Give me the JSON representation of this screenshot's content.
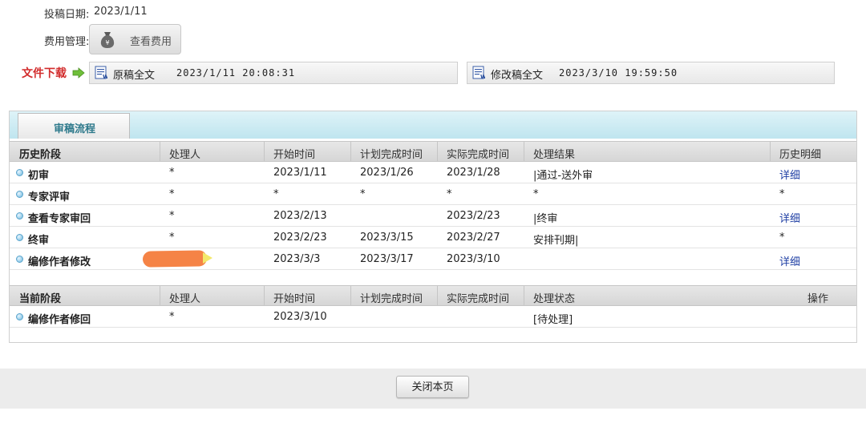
{
  "info": {
    "submit_date_label": "投稿日期:",
    "submit_date_value": "2023/1/11",
    "fee_label": "费用管理:",
    "fee_button": "查看费用"
  },
  "download": {
    "label": "文件下载",
    "original": {
      "name": "原稿全文",
      "time": "2023/1/11 20:08:31"
    },
    "revised": {
      "name": "修改稿全文",
      "time": "2023/3/10 19:59:50"
    }
  },
  "process": {
    "tab_label": "审稿流程",
    "history": {
      "headers": [
        "历史阶段",
        "处理人",
        "开始时间",
        "计划完成时间",
        "实际完成时间",
        "处理结果",
        "历史明细"
      ],
      "rows": [
        {
          "stage": "初审",
          "handler": "*",
          "start": "2023/1/11",
          "plan": "2023/1/26",
          "actual": "2023/1/28",
          "result": "|通过-送外审",
          "detail": "详细"
        },
        {
          "stage": "专家评审",
          "handler": "*",
          "start": "*",
          "plan": "*",
          "actual": "*",
          "result": "*",
          "detail": "*"
        },
        {
          "stage": "查看专家审回",
          "handler": "*",
          "start": "2023/2/13",
          "plan": "",
          "actual": "2023/2/23",
          "result": "|终审",
          "detail": "详细"
        },
        {
          "stage": "终审",
          "handler": "*",
          "start": "2023/2/23",
          "plan": "2023/3/15",
          "actual": "2023/2/27",
          "result": "安排刊期|",
          "detail": "*"
        },
        {
          "stage": "编修作者修改",
          "handler": "",
          "start": "2023/3/3",
          "plan": "2023/3/17",
          "actual": "2023/3/10",
          "result": "",
          "detail": "详细"
        }
      ]
    },
    "current": {
      "headers": [
        "当前阶段",
        "处理人",
        "开始时间",
        "计划完成时间",
        "实际完成时间",
        "处理状态",
        "操作"
      ],
      "rows": [
        {
          "stage": "编修作者修回",
          "handler": "*",
          "start": "2023/3/10",
          "plan": "",
          "actual": "",
          "status": "[待处理]",
          "action": ""
        }
      ]
    }
  },
  "footer": {
    "close_button": "关闭本页"
  },
  "colors": {
    "download_label": "#d22c2c",
    "tab_text": "#2f7a8c",
    "link": "#1f3fa4",
    "redaction": "#f47c3c"
  }
}
